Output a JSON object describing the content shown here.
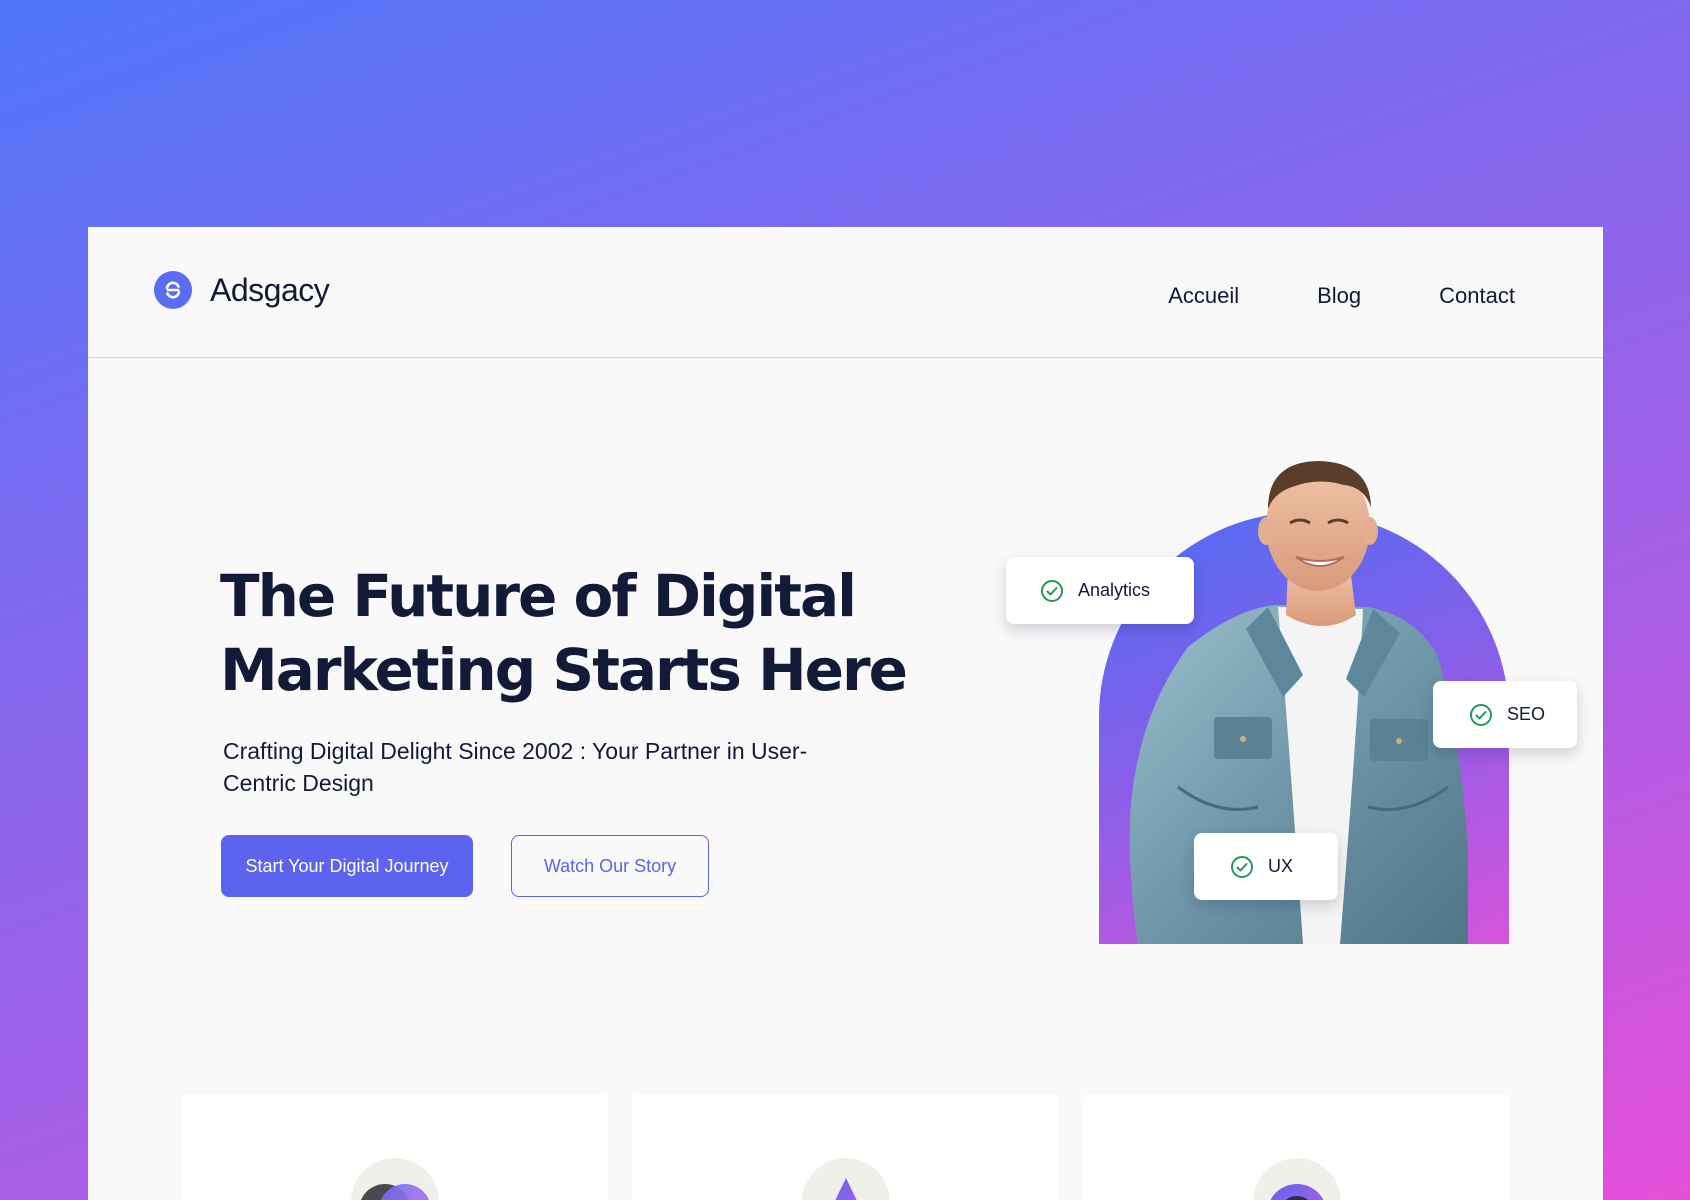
{
  "brand": {
    "name": "Adsgacy",
    "accent_color": "#5c63ee"
  },
  "nav": {
    "items": [
      {
        "label": "Accueil"
      },
      {
        "label": "Blog"
      },
      {
        "label": "Contact"
      }
    ]
  },
  "hero": {
    "title": "The Future of Digital Marketing Starts Here",
    "subtitle": "Crafting Digital Delight Since 2002 : Your Partner in User-Centric Design",
    "primary_button": "Start Your Digital Journey",
    "secondary_button": "Watch Our Story",
    "tags": [
      {
        "label": "Analytics",
        "icon": "check-circle-icon"
      },
      {
        "label": "SEO",
        "icon": "check-circle-icon"
      },
      {
        "label": "UX",
        "icon": "check-circle-icon"
      }
    ]
  },
  "feature_cards": [
    {
      "icon": "overlapping-circles-icon"
    },
    {
      "icon": "triangle-icon"
    },
    {
      "icon": "star-badge-icon"
    }
  ]
}
